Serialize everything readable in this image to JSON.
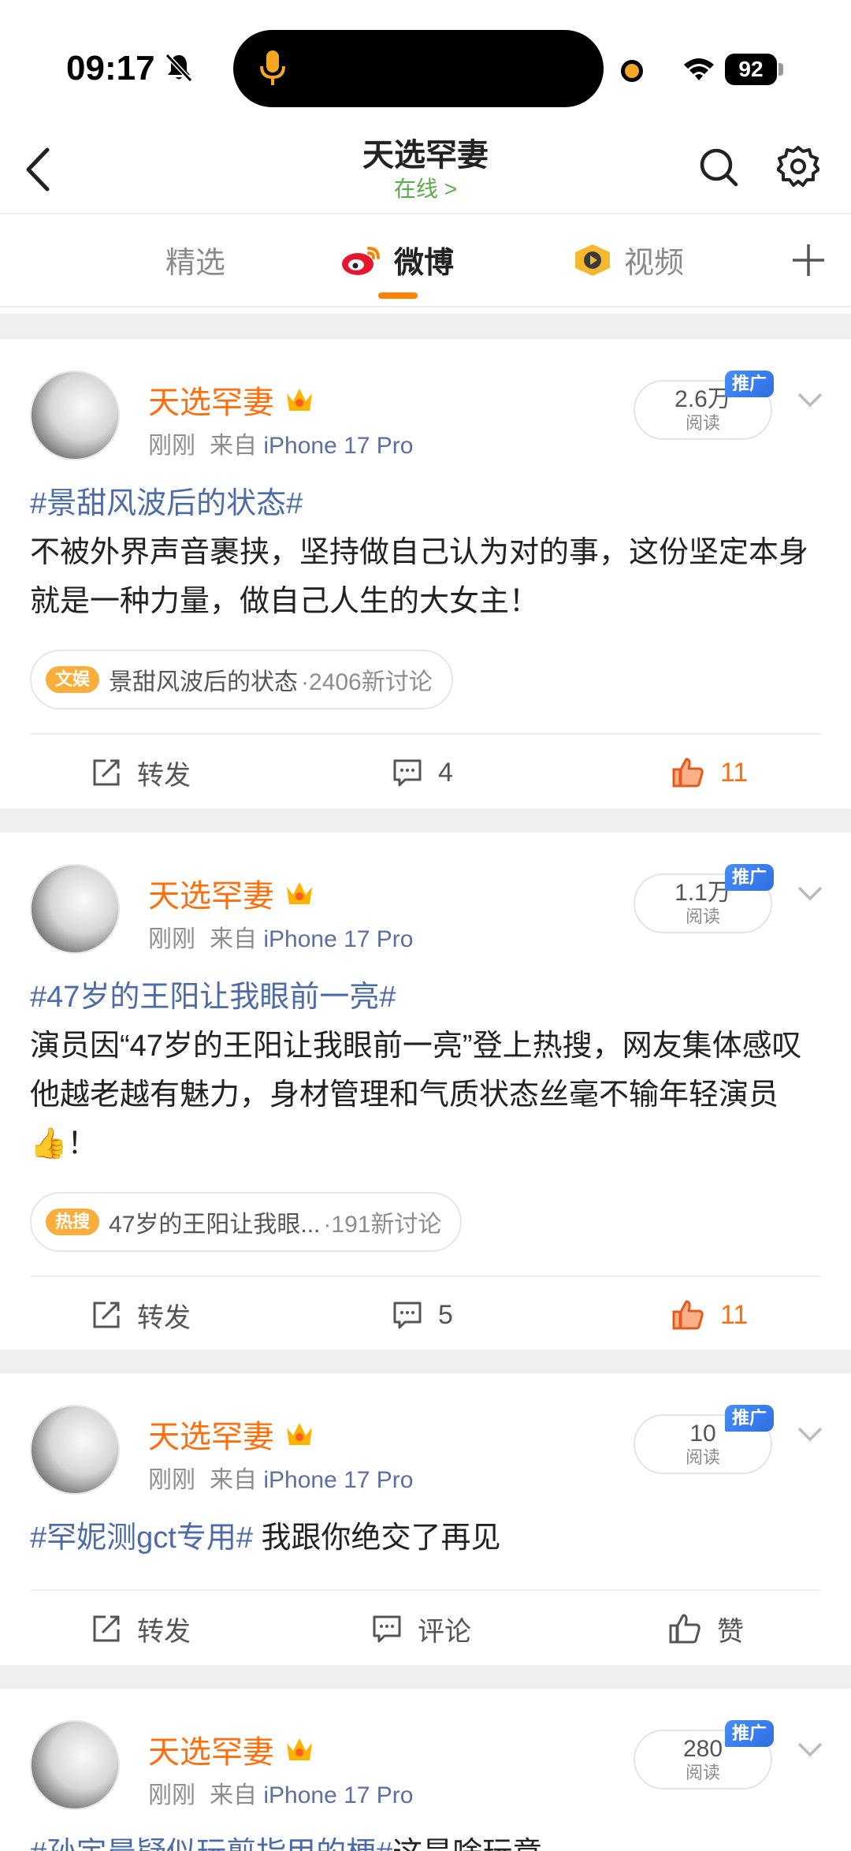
{
  "status_bar": {
    "time": "09:17",
    "battery": "92"
  },
  "header": {
    "title": "天选罕妻",
    "subtitle": "在线 >"
  },
  "tabs": [
    {
      "label": "精选"
    },
    {
      "label": "微博"
    },
    {
      "label": "视频"
    }
  ],
  "posts": [
    {
      "author": "天选罕妻",
      "time": "刚刚",
      "source": "来自",
      "device": "iPhone 17 Pro",
      "reads": "2.6万",
      "reads_label": "阅读",
      "promo": "推广",
      "hashtag": "#景甜风波后的状态#",
      "text": "不被外界声音裹挟，坚持做自己认为对的事，这份坚定本身就是一种力量，做自己人生的大女主！",
      "topic_badge": "文娱",
      "topic_name": "景甜风波后的状态",
      "topic_count": "·2406新讨论",
      "repost": "转发",
      "comments": "4",
      "likes": "11"
    },
    {
      "author": "天选罕妻",
      "time": "刚刚",
      "source": "来自",
      "device": "iPhone 17 Pro",
      "reads": "1.1万",
      "reads_label": "阅读",
      "promo": "推广",
      "hashtag": "#47岁的王阳让我眼前一亮#",
      "text": "演员因“47岁的王阳让我眼前一亮”登上热搜，网友集体感叹他越老越有魅力，身材管理和气质状态丝毫不输年轻演员👍！",
      "topic_badge": "热搜",
      "topic_name": "47岁的王阳让我眼...",
      "topic_count": "·191新讨论",
      "repost": "转发",
      "comments": "5",
      "likes": "11"
    },
    {
      "author": "天选罕妻",
      "time": "刚刚",
      "source": "来自",
      "device": "iPhone 17 Pro",
      "reads": "10",
      "reads_label": "阅读",
      "promo": "推广",
      "hashtag": "#罕妮测gct专用#",
      "text": " 我跟你绝交了再见",
      "repost": "转发",
      "comments": "评论",
      "likes": "赞"
    },
    {
      "author": "天选罕妻",
      "time": "刚刚",
      "source": "来自",
      "device": "iPhone 17 Pro",
      "reads": "280",
      "reads_label": "阅读",
      "promo": "推广",
      "hashtag": "#孙宇晨疑似玩剪指甲的梗#",
      "text": "这是啥玩意"
    }
  ],
  "colors": {
    "accent": "#ff8200",
    "author": "#ff6f0f",
    "hashtag": "#4b6ca8",
    "online": "#5cab4a"
  }
}
